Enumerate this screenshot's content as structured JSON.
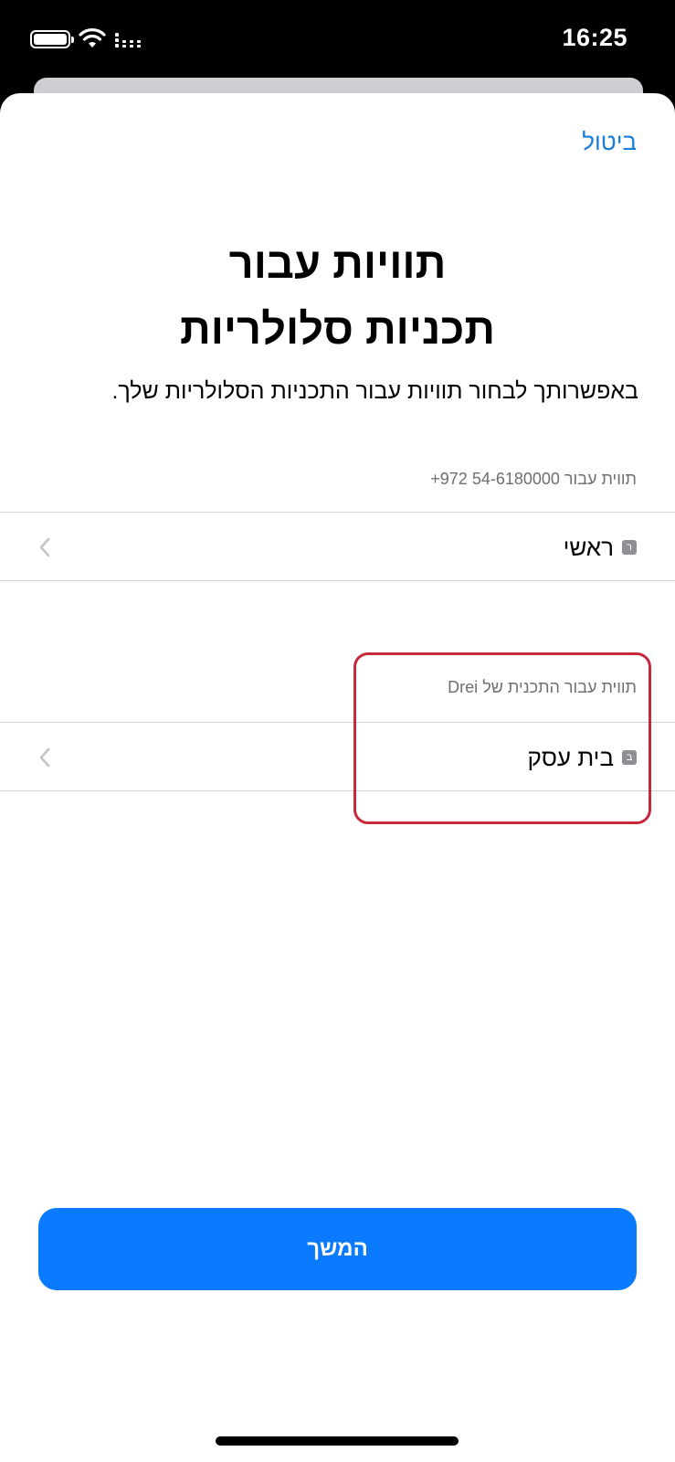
{
  "status_bar": {
    "time": "16:25",
    "icons": [
      "battery-icon",
      "wifi-icon",
      "cellular-signal-icon"
    ]
  },
  "header": {
    "cancel_label": "ביטול"
  },
  "main": {
    "title_line1": "תוויות עבור",
    "title_line2": "תכניות סלולריות",
    "subtitle": "באפשרותך לבחור תוויות עבור התכניות הסלולריות שלך."
  },
  "plans": [
    {
      "section_label": "תווית עבור 54-6180000 972+",
      "badge": "ר",
      "label": "ראשי"
    },
    {
      "section_label": "תווית עבור התכנית של Drei",
      "badge": "ב",
      "label": "בית עסק"
    }
  ],
  "footer": {
    "continue_label": "המשך"
  },
  "colors": {
    "accent": "#0a7aff",
    "link": "#1a7fd6",
    "highlight": "#c8283a",
    "secondary_text": "#6e6e73",
    "separator": "#d1d1d6"
  }
}
